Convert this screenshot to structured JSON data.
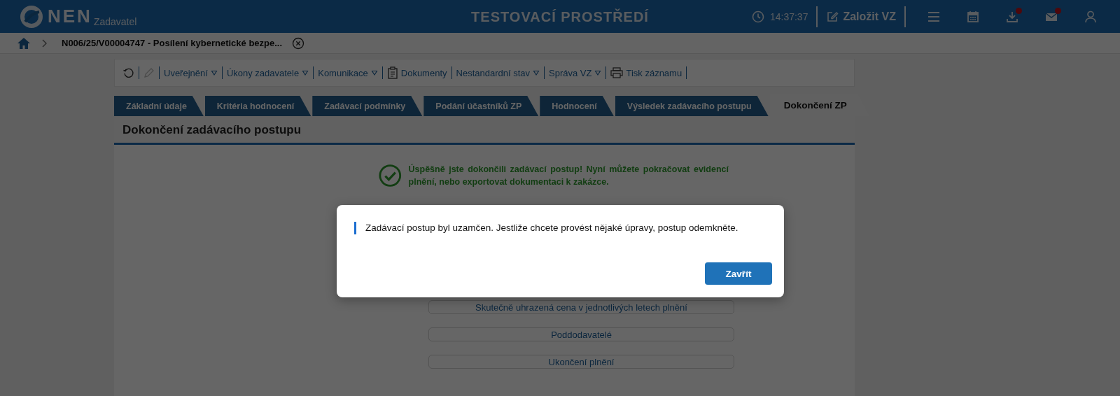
{
  "header": {
    "logo_text": "NEN",
    "logo_subtitle": "Zadavatel",
    "environment": "TESTOVACÍ PROSTŘEDÍ",
    "time": "14:37:37",
    "create_button": "Založit VZ",
    "icons": [
      {
        "kind": "menu",
        "badge": false
      },
      {
        "kind": "calendar",
        "badge": false
      },
      {
        "kind": "download",
        "badge": true
      },
      {
        "kind": "mail",
        "badge": true
      },
      {
        "kind": "user",
        "badge": false
      }
    ]
  },
  "breadcrumb": {
    "title": "N006/25/V00004747 - Posílení kybernetické bezpe..."
  },
  "toolbar": [
    {
      "kind": "refresh",
      "disabled": false
    },
    {
      "kind": "edit",
      "disabled": true
    },
    {
      "kind": "menu",
      "label": "Uveřejnění"
    },
    {
      "kind": "menu",
      "label": "Úkony zadavatele"
    },
    {
      "kind": "menu",
      "label": "Komunikace"
    },
    {
      "kind": "documents",
      "label": "Dokumenty"
    },
    {
      "kind": "menu",
      "label": "Nestandardní stav"
    },
    {
      "kind": "menu",
      "label": "Správa VZ"
    },
    {
      "kind": "print",
      "label": "Tisk záznamu"
    }
  ],
  "tabs": [
    {
      "label": "Základní údaje",
      "selected": false
    },
    {
      "label": "Kritéria hodnocení",
      "selected": false
    },
    {
      "label": "Zadávací podmínky",
      "selected": false
    },
    {
      "label": "Podání účastníků ZP",
      "selected": false
    },
    {
      "label": "Hodnocení",
      "selected": false
    },
    {
      "label": "Výsledek zadávacího postupu",
      "selected": false
    },
    {
      "label": "Dokončení ZP",
      "selected": true
    }
  ],
  "section_title": "Dokončení zadávacího postupu",
  "success_message": "Úspěšně jste dokončili zadávací postup! Nyní můžete pokračovat evidencí plnění, nebo exportovat dokumentaci k zakázce.",
  "action_buttons": [
    "Skutečně uhrazená cena v jednotlivých letech plnění",
    "Poddodavatelé",
    "Ukončení plnění"
  ],
  "dialog": {
    "message": "Zadávací postup byl uzamčen. Jestliže chcete provést nějaké úpravy, postup odemkněte.",
    "button": "Zavřít"
  }
}
